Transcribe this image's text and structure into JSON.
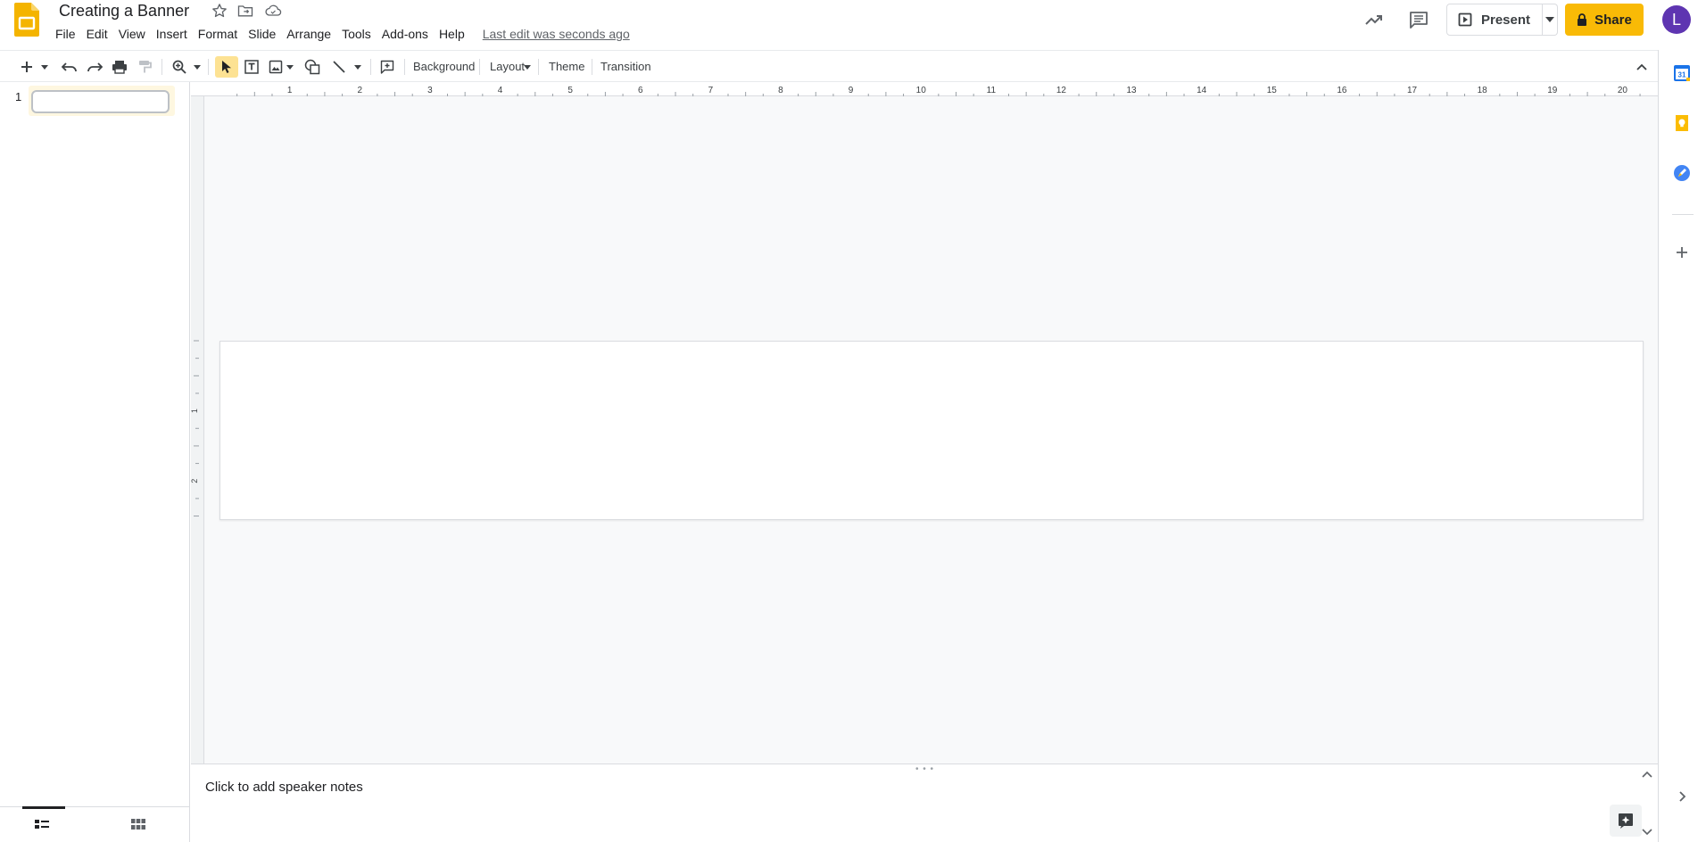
{
  "header": {
    "title": "Creating a Banner",
    "last_edit": "Last edit was seconds ago",
    "menu": [
      "File",
      "Edit",
      "View",
      "Insert",
      "Format",
      "Slide",
      "Arrange",
      "Tools",
      "Add-ons",
      "Help"
    ],
    "present_label": "Present",
    "share_label": "Share",
    "avatar_initial": "L"
  },
  "toolbar": {
    "background_label": "Background",
    "layout_label": "Layout",
    "theme_label": "Theme",
    "transition_label": "Transition"
  },
  "filmstrip": {
    "slide_number": "1"
  },
  "ruler": {
    "horizontal_ticks": [
      "1",
      "2",
      "3",
      "4",
      "5",
      "6",
      "7",
      "8",
      "9",
      "10",
      "11",
      "12",
      "13",
      "14",
      "15",
      "16",
      "17",
      "18",
      "19",
      "20"
    ],
    "vertical_ticks": [
      "1",
      "2"
    ]
  },
  "notes": {
    "placeholder": "Click to add speaker notes"
  },
  "colors": {
    "accent_yellow": "#f9ba06",
    "avatar_purple": "#5e35b1",
    "canvas_bg": "#f8f9fa"
  },
  "side_panel": {
    "icons": [
      "calendar-icon",
      "keep-icon",
      "tasks-icon",
      "add-icon"
    ]
  }
}
